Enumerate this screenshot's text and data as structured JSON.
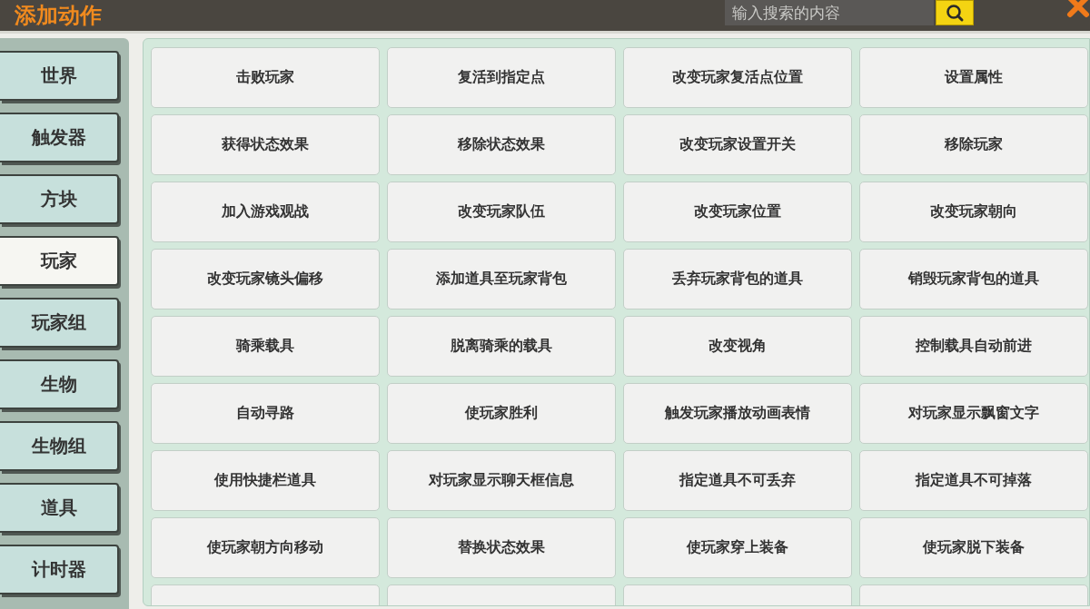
{
  "title": "添加动作",
  "search": {
    "placeholder": "输入搜索的内容"
  },
  "categories": [
    {
      "label": "世界",
      "selected": false
    },
    {
      "label": "触发器",
      "selected": false
    },
    {
      "label": "方块",
      "selected": false
    },
    {
      "label": "玩家",
      "selected": true
    },
    {
      "label": "玩家组",
      "selected": false
    },
    {
      "label": "生物",
      "selected": false
    },
    {
      "label": "生物组",
      "selected": false
    },
    {
      "label": "道具",
      "selected": false
    },
    {
      "label": "计时器",
      "selected": false
    }
  ],
  "actions": [
    "击败玩家",
    "复活到指定点",
    "改变玩家复活点位置",
    "设置属性",
    "获得状态效果",
    "移除状态效果",
    "改变玩家设置开关",
    "移除玩家",
    "加入游戏观战",
    "改变玩家队伍",
    "改变玩家位置",
    "改变玩家朝向",
    "改变玩家镜头偏移",
    "添加道具至玩家背包",
    "丢弃玩家背包的道具",
    "销毁玩家背包的道具",
    "骑乘载具",
    "脱离骑乘的载具",
    "改变视角",
    "控制载具自动前进",
    "自动寻路",
    "使玩家胜利",
    "触发玩家播放动画表情",
    "对玩家显示飘窗文字",
    "使用快捷栏道具",
    "对玩家显示聊天框信息",
    "指定道具不可丢弃",
    "指定道具不可掉落",
    "使玩家朝方向移动",
    "替换状态效果",
    "使玩家穿上装备",
    "使玩家脱下装备"
  ]
}
